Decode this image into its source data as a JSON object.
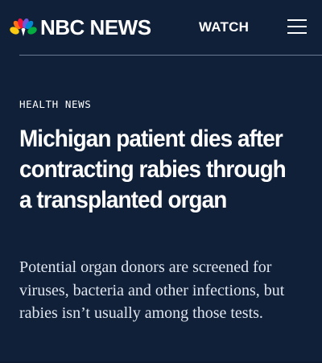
{
  "header": {
    "logo_text": "NBC NEWS",
    "logo_icon": "nbc-peacock-icon",
    "watch_label": "WATCH",
    "menu_icon": "hamburger-menu-icon"
  },
  "article": {
    "category": "HEALTH NEWS",
    "headline": "Michigan patient dies after contracting rabies through a transplanted organ",
    "dek": "Potential organ donors are screened for viruses, bacteria and other infections, but rabies isn’t usually among those tests."
  },
  "colors": {
    "background": "#102039",
    "text": "#ffffff",
    "divider": "#6b7a90",
    "peacock": [
      "#fccc12",
      "#ef1541",
      "#6e55dc",
      "#0089d0",
      "#05ac3f",
      "#ff7112"
    ]
  }
}
